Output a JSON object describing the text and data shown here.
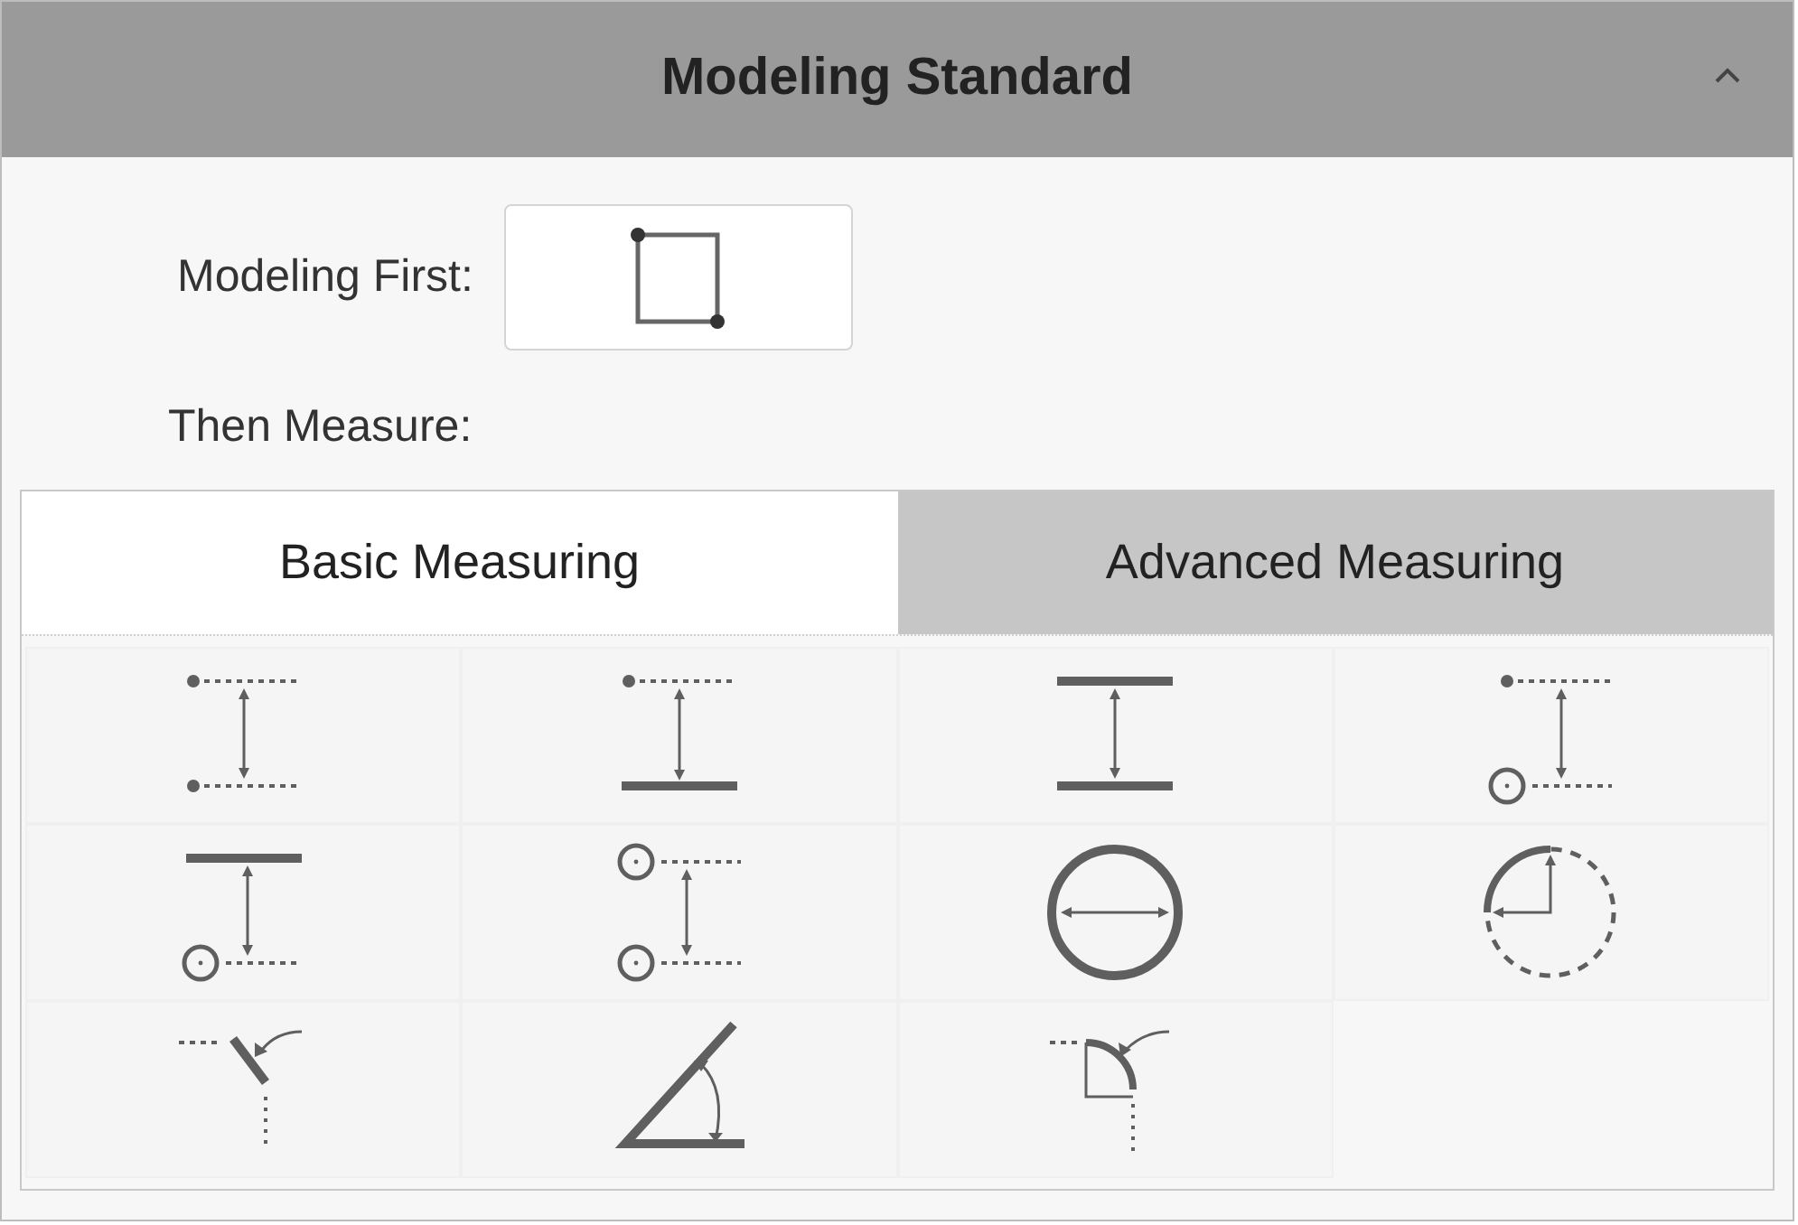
{
  "panel": {
    "title": "Modeling Standard",
    "expanded": true
  },
  "modeling_first": {
    "label": "Modeling First:"
  },
  "then_measure": {
    "label": "Then Measure:"
  },
  "tabs": [
    {
      "label": "Basic Measuring",
      "selected": true
    },
    {
      "label": "Advanced Measuring",
      "selected": false
    }
  ],
  "tools": [
    {
      "kind": "point-point"
    },
    {
      "kind": "point-line"
    },
    {
      "kind": "line-line"
    },
    {
      "kind": "point-circle"
    },
    {
      "kind": "line-circle"
    },
    {
      "kind": "circle-circle"
    },
    {
      "kind": "diameter"
    },
    {
      "kind": "radius"
    },
    {
      "kind": "edge-angle"
    },
    {
      "kind": "angle"
    },
    {
      "kind": "arc-angle"
    }
  ]
}
